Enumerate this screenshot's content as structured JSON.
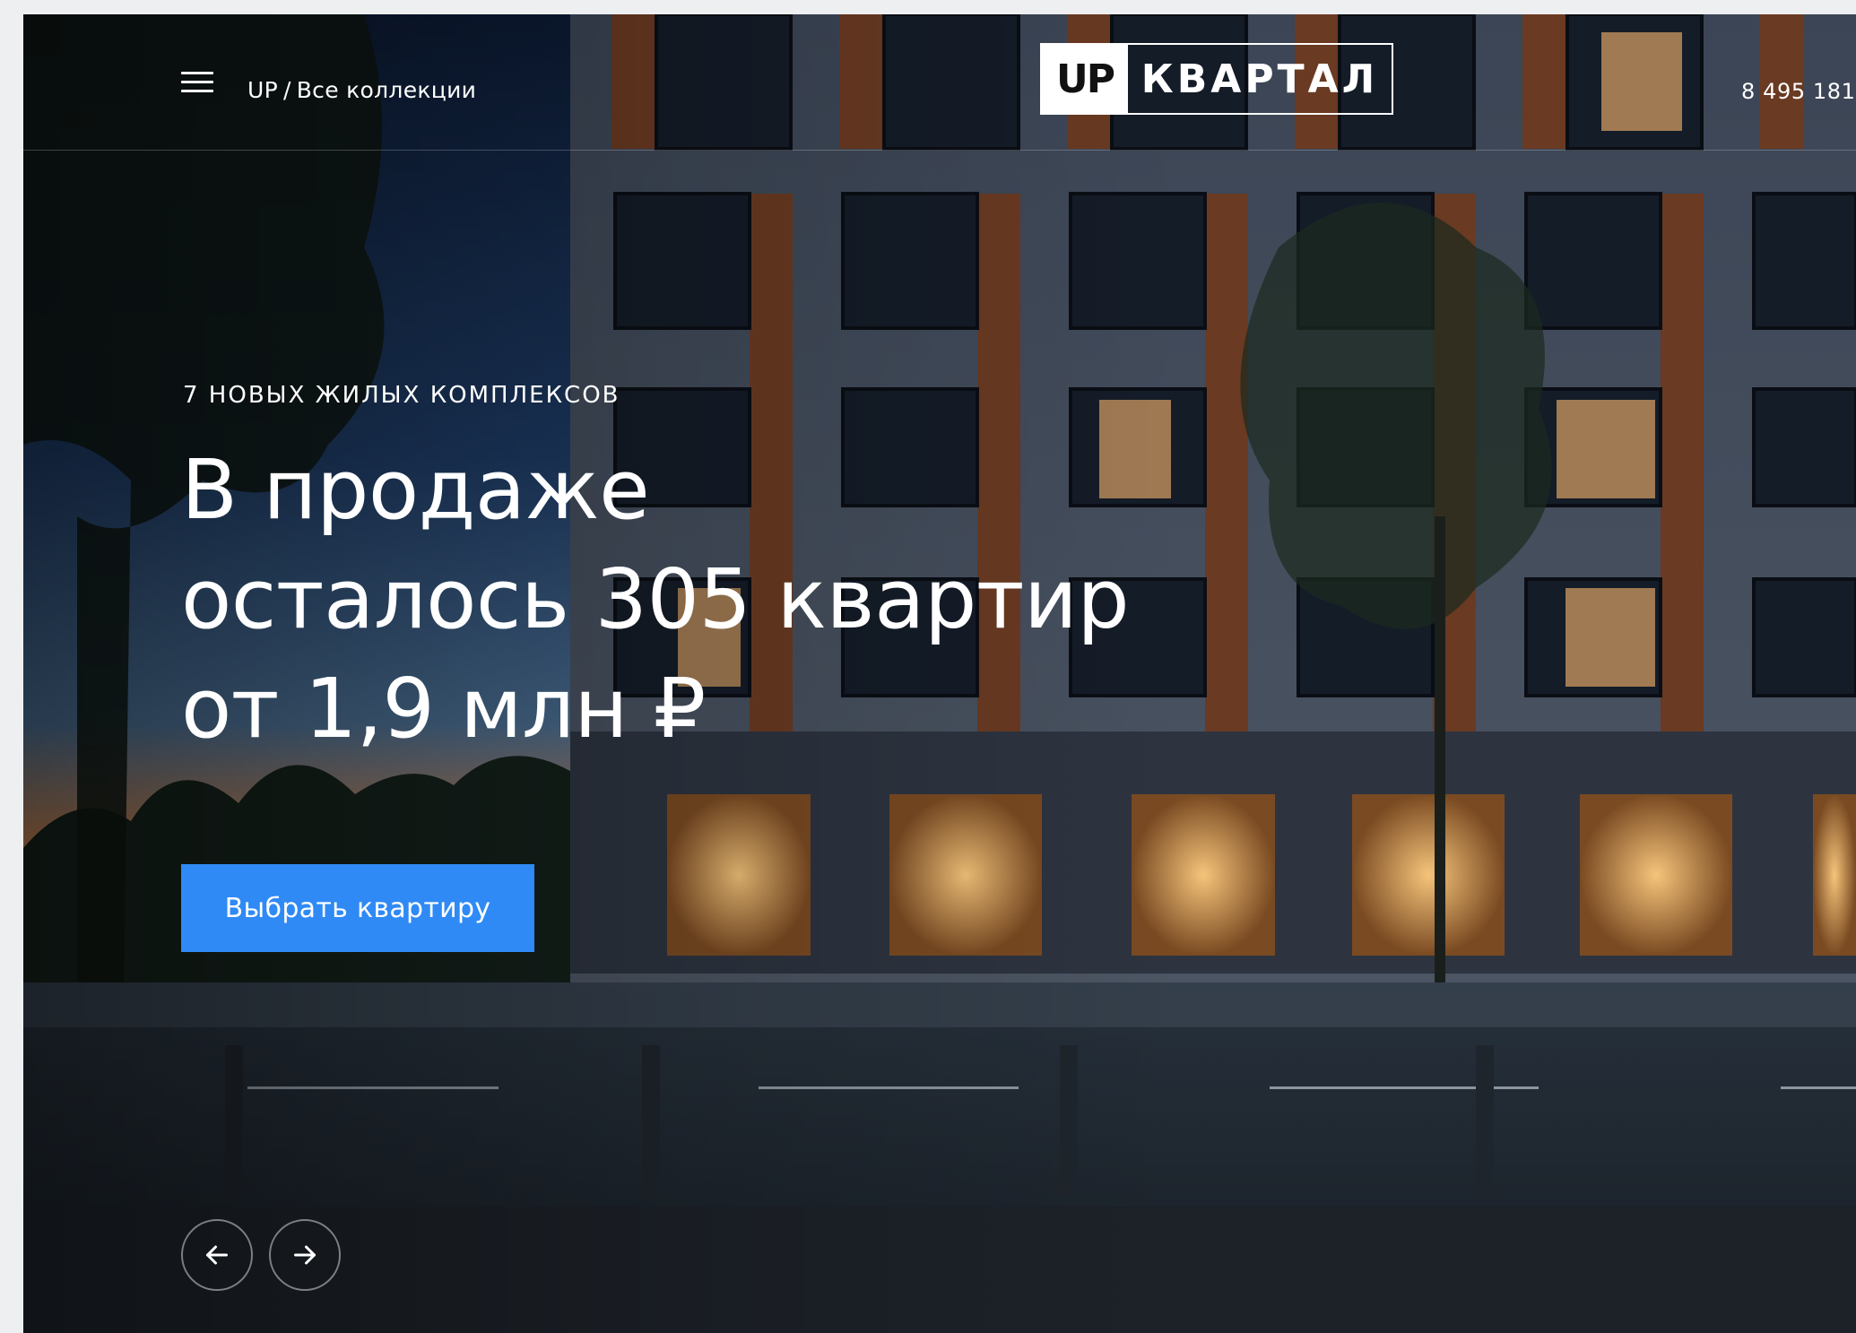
{
  "header": {
    "breadcrumb_home": "UP",
    "breadcrumb_sep": "/",
    "breadcrumb_current": "Все коллекции",
    "logo_mark": "UP",
    "logo_text": "КВАРТАЛ",
    "phone": "8 495 181"
  },
  "hero": {
    "eyebrow": "7 НОВЫХ ЖИЛЫХ КОМПЛЕКСОВ",
    "headline_line1": "В продаже",
    "headline_line2": "осталось 305 квартир",
    "headline_line3": "от 1,9 млн ₽",
    "cta_label": "Выбрать квартиру"
  },
  "slider": {
    "prev_icon": "arrow-left-icon",
    "next_icon": "arrow-right-icon"
  },
  "colors": {
    "accent": "#2f8af5",
    "sky_top": "#0f1d36",
    "sky_bottom": "#d17b3a"
  }
}
